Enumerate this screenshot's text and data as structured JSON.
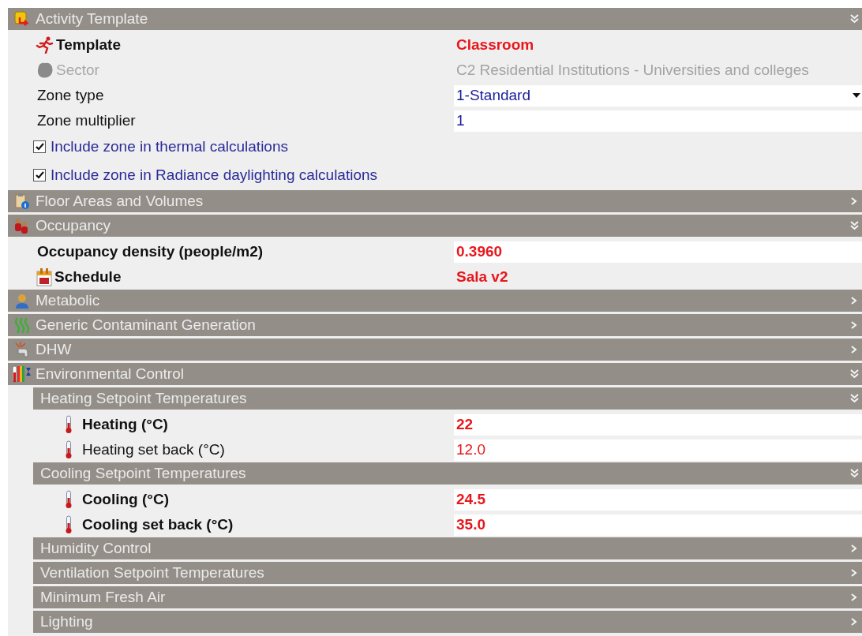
{
  "sections": [
    {
      "title": "Activity Template",
      "expanded": true,
      "rows": [
        {
          "kind": "text",
          "label": "Template",
          "bold": true,
          "disabled": false,
          "value": "Classroom",
          "color": "#e8171c"
        },
        {
          "kind": "text",
          "label": "Sector",
          "bold": false,
          "disabled": true,
          "value": "C2 Residential Institutions - Universities and colleges",
          "color": "#a3a3a3"
        },
        {
          "kind": "dropdown",
          "label": "Zone type",
          "bold": false,
          "disabled": false,
          "value": "1-Standard",
          "color": "#1c1c9c"
        },
        {
          "kind": "input",
          "label": "Zone multiplier",
          "bold": false,
          "disabled": false,
          "value": "1",
          "color": "#1c1c9c"
        },
        {
          "kind": "checkbox",
          "label": "Include zone in thermal calculations",
          "checked": true
        },
        {
          "kind": "checkbox",
          "label": "Include zone in Radiance daylighting calculations",
          "checked": true
        }
      ]
    },
    {
      "title": "Floor Areas and Volumes",
      "expanded": false
    },
    {
      "title": "Occupancy",
      "expanded": true,
      "rows": [
        {
          "kind": "input",
          "label": "Occupancy density (people/m2)",
          "bold": true,
          "disabled": false,
          "value": "0.3960",
          "color": "#e8171c"
        },
        {
          "kind": "text",
          "label": "Schedule",
          "bold": true,
          "disabled": false,
          "value": "Sala v2",
          "color": "#e8171c"
        }
      ]
    },
    {
      "title": "Metabolic",
      "expanded": false
    },
    {
      "title": "Generic Contaminant Generation",
      "expanded": false
    },
    {
      "title": "DHW",
      "expanded": false
    },
    {
      "title": "Environmental Control",
      "expanded": true,
      "children": [
        {
          "title": "Heating Setpoint Temperatures",
          "expanded": true,
          "rows": [
            {
              "kind": "input",
              "label": "Heating (°C)",
              "bold": true,
              "disabled": false,
              "value": "22",
              "color": "#e8171c"
            },
            {
              "kind": "input",
              "label": "Heating set back (°C)",
              "bold": false,
              "disabled": false,
              "value": "12.0",
              "color": "#e8171c"
            }
          ]
        },
        {
          "title": "Cooling Setpoint Temperatures",
          "expanded": true,
          "rows": [
            {
              "kind": "input",
              "label": "Cooling (°C)",
              "bold": true,
              "disabled": false,
              "value": "24.5",
              "color": "#e8171c"
            },
            {
              "kind": "input",
              "label": "Cooling set back (°C)",
              "bold": true,
              "disabled": false,
              "value": "35.0",
              "color": "#e8171c"
            }
          ]
        },
        {
          "title": "Humidity Control",
          "expanded": false
        },
        {
          "title": "Ventilation Setpoint Temperatures",
          "expanded": false
        },
        {
          "title": "Minimum Fresh Air",
          "expanded": false
        },
        {
          "title": "Lighting",
          "expanded": false
        }
      ]
    }
  ]
}
